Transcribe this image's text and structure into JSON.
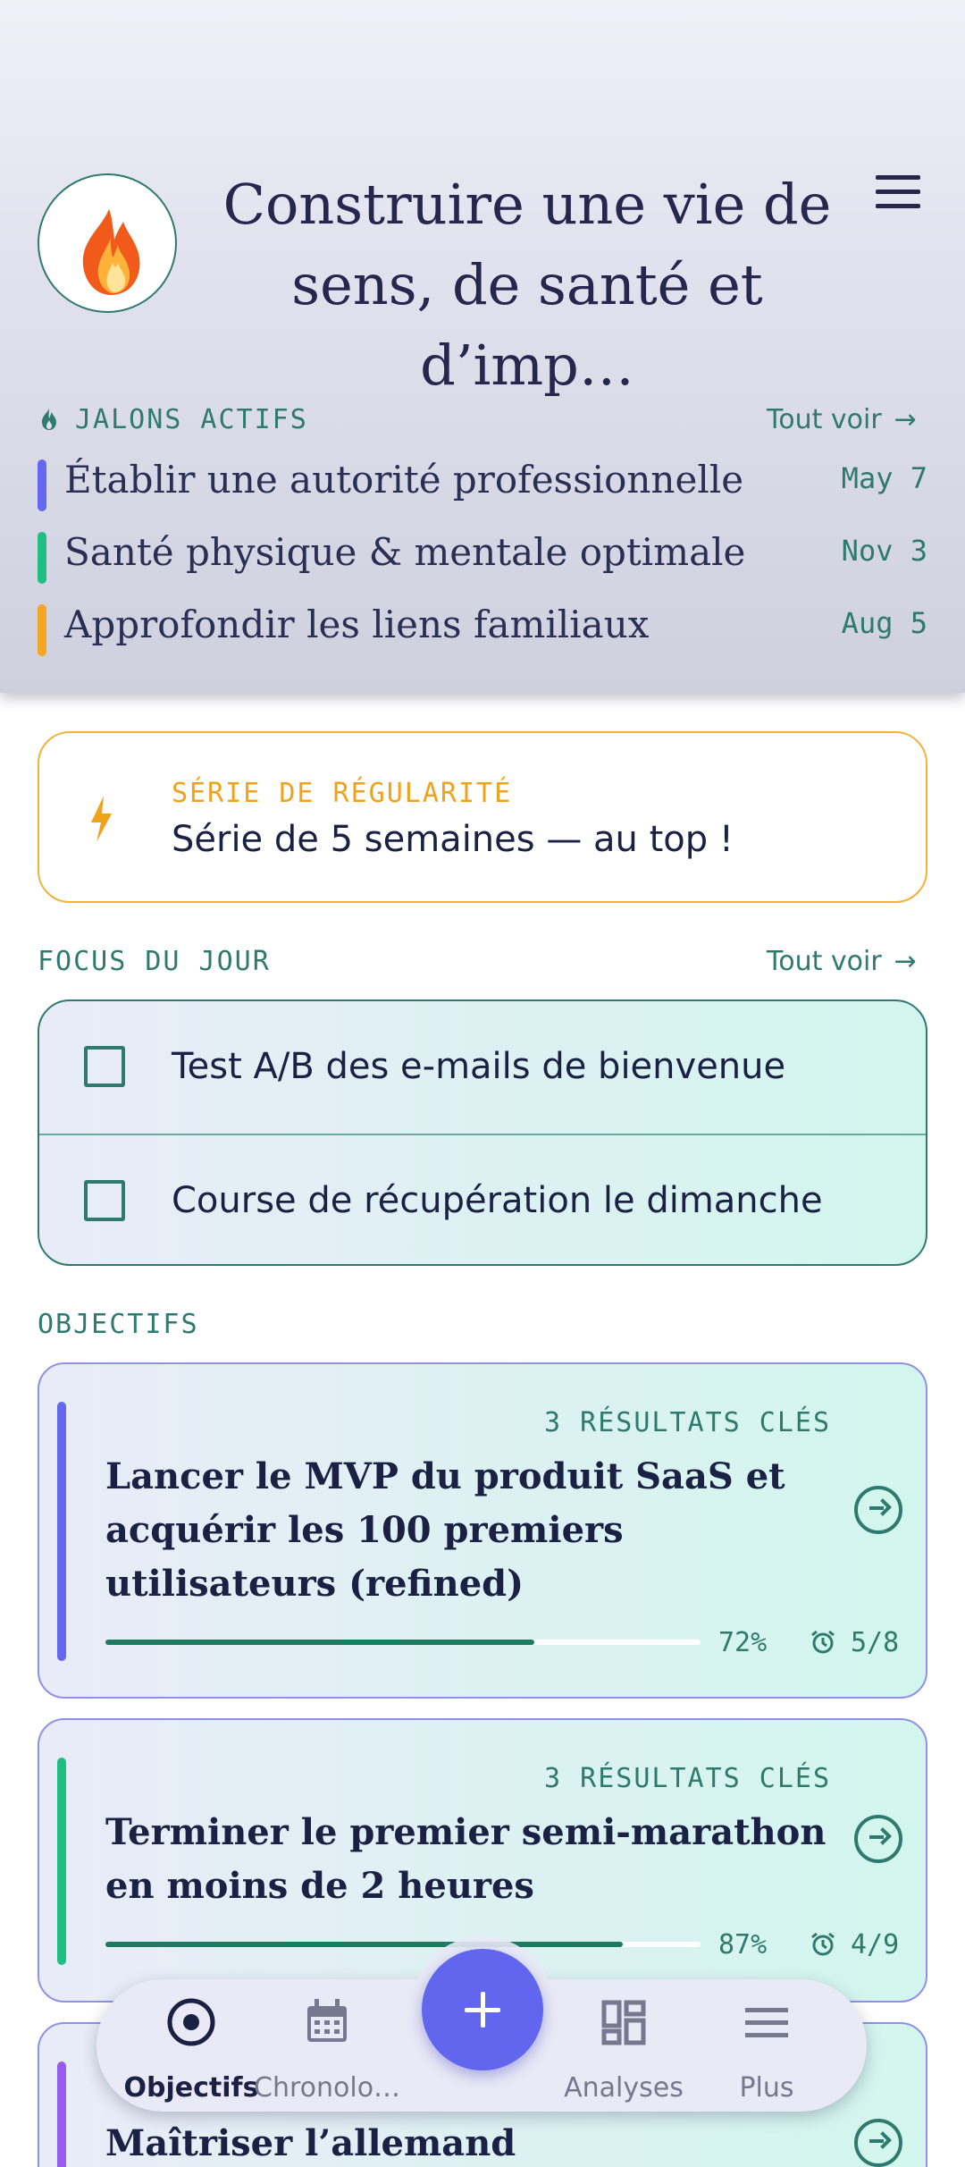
{
  "header": {
    "title": "Construire une vie de sens, de santé et d’imp…",
    "avatar_icon": "flame-icon",
    "menu_icon": "hamburger-menu-icon"
  },
  "milestones": {
    "label": "JALONS ACTIFS",
    "see_all": "Tout voir",
    "items": [
      {
        "title": "Établir une autorité professionnelle",
        "date": "May 7",
        "color": "#6468f0"
      },
      {
        "title": "Santé physique & mentale optimale",
        "date": "Nov 3",
        "color": "#1fbf84"
      },
      {
        "title": "Approfondir les liens familiaux",
        "date": "Aug 5",
        "color": "#f5a623"
      }
    ]
  },
  "streak": {
    "label": "SÉRIE DE RÉGULARITÉ",
    "text": "Série de 5 semaines — au top !",
    "icon": "lightning-bolt-icon"
  },
  "focus": {
    "label": "FOCUS DU JOUR",
    "see_all": "Tout voir",
    "tasks": [
      {
        "title": "Test A/B des e-mails de bienvenue",
        "done": false
      },
      {
        "title": "Course de récupération le dimanche",
        "done": false
      }
    ]
  },
  "goals": {
    "label": "OBJECTIFS",
    "items": [
      {
        "key_results": "3 RÉSULTATS CLÉS",
        "title": "Lancer le MVP du produit SaaS et acquérir les 100 premiers utilisateurs (refined)",
        "progress_label": "72%",
        "progress": 0.72,
        "count": "5/8",
        "color": "#6468f0"
      },
      {
        "key_results": "3 RÉSULTATS CLÉS",
        "title": "Terminer le premier semi-marathon en moins de 2 heures",
        "progress_label": "87%",
        "progress": 0.87,
        "count": "4/9",
        "color": "#1fbf84"
      },
      {
        "title": "Maîtriser l’allemand conversationnel",
        "color": "#9a5cf0"
      }
    ]
  },
  "nav": {
    "items": [
      {
        "label": "Objectifs",
        "icon": "target-icon",
        "active": true
      },
      {
        "label": "Chronolo…",
        "icon": "calendar-icon",
        "active": false
      },
      {
        "label": "Analyses",
        "icon": "dashboard-icon",
        "active": false
      },
      {
        "label": "Plus",
        "icon": "menu-icon",
        "active": false
      }
    ],
    "fab_icon": "plus-icon"
  }
}
